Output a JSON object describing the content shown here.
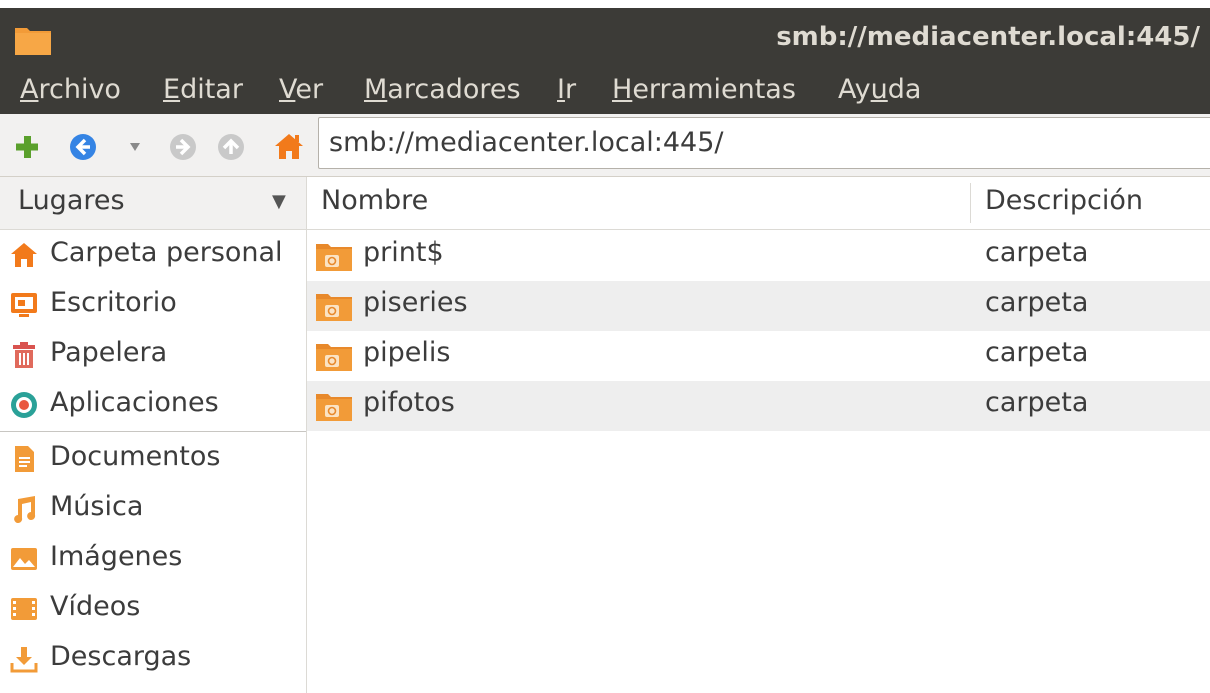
{
  "window": {
    "title": "smb://mediacenter.local:445/"
  },
  "menubar": {
    "items": [
      {
        "pre": "",
        "u": "A",
        "post": "rchivo"
      },
      {
        "pre": "",
        "u": "E",
        "post": "ditar"
      },
      {
        "pre": "",
        "u": "V",
        "post": "er"
      },
      {
        "pre": "",
        "u": "M",
        "post": "arcadores"
      },
      {
        "pre": "",
        "u": "I",
        "post": "r"
      },
      {
        "pre": "",
        "u": "H",
        "post": "erramientas"
      },
      {
        "pre": "Ay",
        "u": "u",
        "post": "da"
      }
    ]
  },
  "toolbar": {
    "location": "smb://mediacenter.local:445/"
  },
  "sidebar": {
    "header": "Lugares",
    "places": [
      {
        "label": "Carpeta personal",
        "icon": "home-icon"
      },
      {
        "label": "Escritorio",
        "icon": "desktop-icon"
      },
      {
        "label": "Papelera",
        "icon": "trash-icon"
      },
      {
        "label": "Aplicaciones",
        "icon": "applications-icon"
      },
      {
        "label": "Documentos",
        "icon": "documents-icon"
      },
      {
        "label": "Música",
        "icon": "music-icon"
      },
      {
        "label": "Imágenes",
        "icon": "pictures-icon"
      },
      {
        "label": "Vídeos",
        "icon": "videos-icon"
      },
      {
        "label": "Descargas",
        "icon": "downloads-icon"
      }
    ]
  },
  "filelist": {
    "columns": [
      "Nombre",
      "Descripción"
    ],
    "rows": [
      {
        "name": "print$",
        "description": "carpeta"
      },
      {
        "name": "piseries",
        "description": "carpeta"
      },
      {
        "name": "pipelis",
        "description": "carpeta"
      },
      {
        "name": "pifotos",
        "description": "carpeta"
      }
    ]
  },
  "colors": {
    "titlebar": "#3c3b37",
    "folder": "#f29b38",
    "home": "#f27a1b",
    "back": "#3584e4",
    "add": "#5aa02c"
  }
}
